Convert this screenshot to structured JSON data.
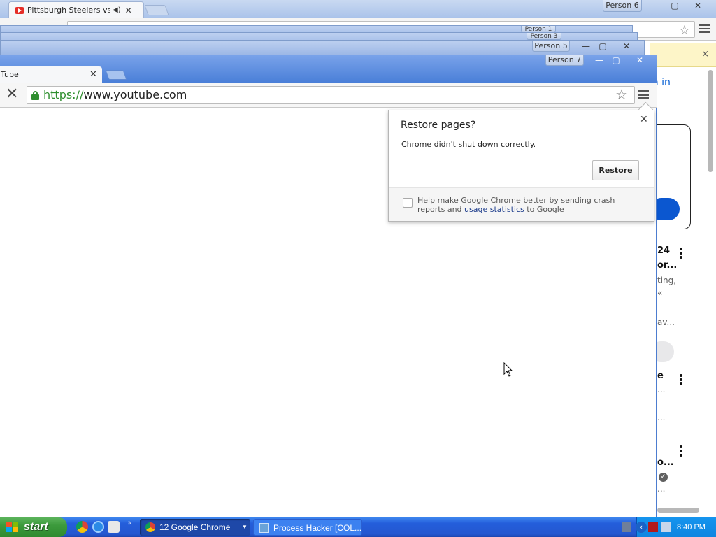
{
  "background_window": {
    "tab_title": "Pittsburgh Steelers vs. Cl",
    "person_label": "Person 6",
    "minimize": "—",
    "maximize": "▢",
    "close": "✕",
    "infobar_close": "×",
    "page_fragments": {
      "signin": "ign in",
      "item1_title_a": "24",
      "item1_title_b": "or...",
      "item1_sub_a": "ting,",
      "item1_sub_b": "«",
      "item1_sub_c": "av...",
      "item2_title": "e",
      "item2_sub": "...",
      "item3_title": "o...",
      "item3_sub": "..."
    }
  },
  "stacked_windows": {
    "person_labels": [
      "Person 1",
      "Person 3",
      "Person 5"
    ]
  },
  "foreground_window": {
    "tab_title": "Tube",
    "person_label": "Person 7",
    "url_scheme": "https://",
    "url_rest": "www.youtube.com"
  },
  "restore_bubble": {
    "title": "Restore pages?",
    "message": "Chrome didn't shut down correctly.",
    "restore_button": "Restore",
    "checkbox_checked": false,
    "crash_text_before": "Help make Google Chrome better by sending crash reports and",
    "crash_link": "usage statistics",
    "crash_text_after": " to Google"
  },
  "taskbar": {
    "start_label": "start",
    "quicklaunch_more": "»",
    "tasks": [
      {
        "label": "12 Google Chrome",
        "icon": "chrome-icon",
        "active": true
      },
      {
        "label": "Process Hacker [COL...",
        "icon": "process-hacker-icon",
        "active": false
      }
    ],
    "clock": "8:40 PM"
  },
  "colors": {
    "url_scheme": "#2f8f2f",
    "link": "#1a3a8a",
    "youtube_red": "#e52d27",
    "taskbar_blue": "#245edb",
    "start_green": "#3c9a3c"
  }
}
